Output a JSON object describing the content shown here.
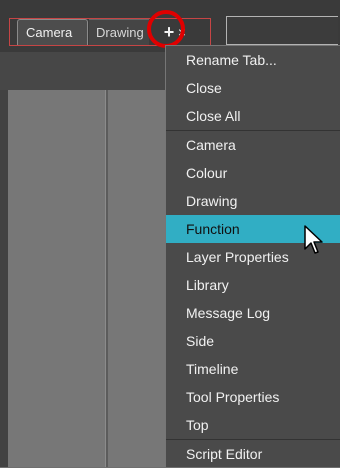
{
  "tabs": [
    {
      "label": "Camera"
    },
    {
      "label": "Drawing"
    }
  ],
  "tab_actions": {
    "add_icon": "plus-icon",
    "close_icon": "close-icon",
    "add_symbol": "+",
    "close_symbol": "×"
  },
  "menu": {
    "items": [
      {
        "label": "Rename Tab..."
      },
      {
        "label": "Close"
      },
      {
        "label": "Close All"
      },
      {
        "label": "Camera"
      },
      {
        "label": "Colour"
      },
      {
        "label": "Drawing"
      },
      {
        "label": "Function"
      },
      {
        "label": "Layer Properties"
      },
      {
        "label": "Library"
      },
      {
        "label": "Message Log"
      },
      {
        "label": "Side"
      },
      {
        "label": "Timeline"
      },
      {
        "label": "Tool Properties"
      },
      {
        "label": "Top"
      },
      {
        "label": "Script Editor"
      }
    ],
    "selected_label": "Function"
  },
  "colors": {
    "highlight": "#31aec4",
    "annotation_red": "#e00000"
  }
}
